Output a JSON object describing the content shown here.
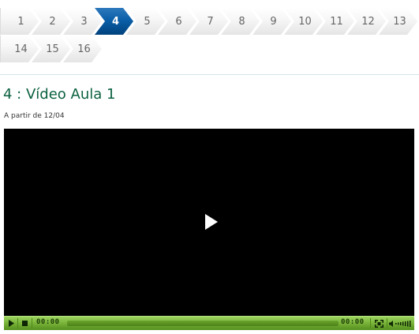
{
  "stepper": {
    "active_index": 3,
    "steps": [
      {
        "label": "1"
      },
      {
        "label": "2"
      },
      {
        "label": "3"
      },
      {
        "label": "4"
      },
      {
        "label": "5"
      },
      {
        "label": "6"
      },
      {
        "label": "7"
      },
      {
        "label": "8"
      },
      {
        "label": "9"
      },
      {
        "label": "10"
      },
      {
        "label": "11"
      },
      {
        "label": "12"
      },
      {
        "label": "13"
      },
      {
        "label": "14"
      },
      {
        "label": "15"
      },
      {
        "label": "16"
      }
    ]
  },
  "lesson": {
    "title": "4 : Vídeo Aula 1",
    "availability": "A partir de 12/04"
  },
  "player": {
    "elapsed_time": "00:00",
    "total_time": "00:00",
    "icons": {
      "center_play": "play-icon",
      "play": "play-icon",
      "stop": "stop-icon",
      "fullscreen": "fullscreen-icon",
      "volume": "volume-icon"
    }
  },
  "colors": {
    "active_step": "#0a5fa8",
    "title": "#0b6140",
    "controls_bar": "#7bb53b",
    "video_background": "#000000"
  }
}
